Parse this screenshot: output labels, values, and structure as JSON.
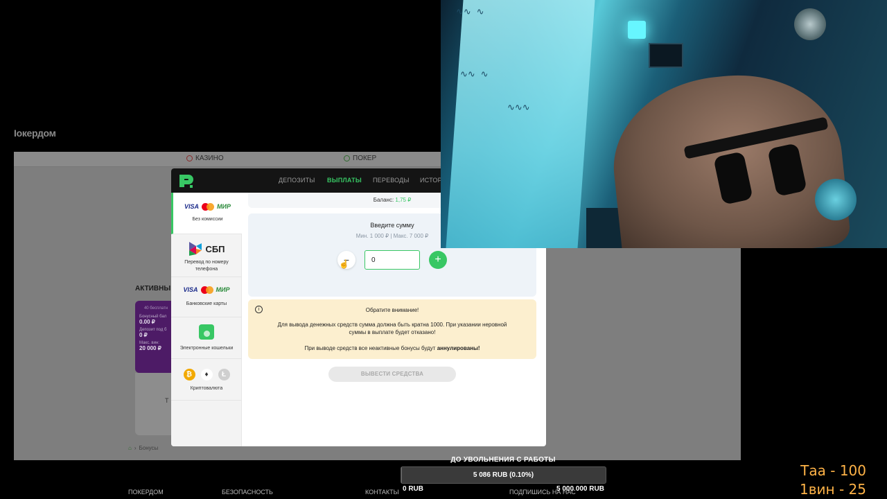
{
  "site": {
    "logo": "Iокердом",
    "tabs": [
      "КАЗИНО",
      "ПОКЕР"
    ],
    "active_bonuses_label": "АКТИВНЫ",
    "bonus_card": {
      "title": "40 бесплатн",
      "rows": [
        {
          "key": "Бонусный бал",
          "value": "0.00 ₽"
        },
        {
          "key": "Депозит под б",
          "value": "0 ₽"
        },
        {
          "key": "Макс. вин:",
          "value": "20 000 ₽"
        }
      ],
      "lower_text": "Т"
    },
    "breadcrumb": "Бонусы"
  },
  "modal": {
    "tabs": [
      "ДЕПОЗИТЫ",
      "ВЫПЛАТЫ",
      "ПЕРЕВОДЫ",
      "ИСТОР"
    ],
    "active_tab": "ВЫПЛАТЫ",
    "accent_color": "#38c764",
    "methods": [
      {
        "brands": [
          "VISA",
          "mastercard",
          "МИР"
        ],
        "label": "Без комиссии",
        "active": true
      },
      {
        "brands": [
          "СБП"
        ],
        "label": "Перевод по номеру телефона",
        "active": false
      },
      {
        "brands": [
          "VISA",
          "mastercard",
          "МИР"
        ],
        "label": "Банковские карты",
        "active": false
      },
      {
        "brands": [
          "wallet"
        ],
        "label": "Электронные кошельки",
        "active": false
      },
      {
        "brands": [
          "bitcoin",
          "ethereum",
          "litecoin"
        ],
        "label": "Криптовалюта",
        "active": false
      }
    ],
    "balance_label": "Баланс:",
    "balance_value": "1,75 ₽",
    "amount_title": "Введите сумму",
    "amount_limits": "Мин. 1 000 ₽ | Макс. 7 000 ₽",
    "amount_value": "0",
    "notice_title": "Обратите внимание!",
    "notice_body": "Для вывода денежных средств сумма должна быть кратна 1000. При указании неровной суммы в выплате будет отказано!",
    "notice_bonus_prefix": "При выводе средств все неактивные бонусы будут",
    "notice_bonus_bold": "аннулированы!",
    "withdraw_button": "ВЫВЕСТИ СРЕДСТВА"
  },
  "footer": {
    "links": [
      "ПОКЕРДОМ",
      "БЕЗОПАСНОСТЬ",
      "КОНТАКТЫ",
      "ПОДПИШИСЬ НА НАС"
    ]
  },
  "goal": {
    "title": "ДО УВОЛЬНЕНИЯ С РАБОТЫ",
    "value": "5 086 RUB (0.10%)",
    "progress_fraction": 0.001,
    "min": "0 RUB",
    "max": "5 000 000 RUB"
  },
  "counters": [
    "Таа - 100",
    "1вин - 25"
  ]
}
